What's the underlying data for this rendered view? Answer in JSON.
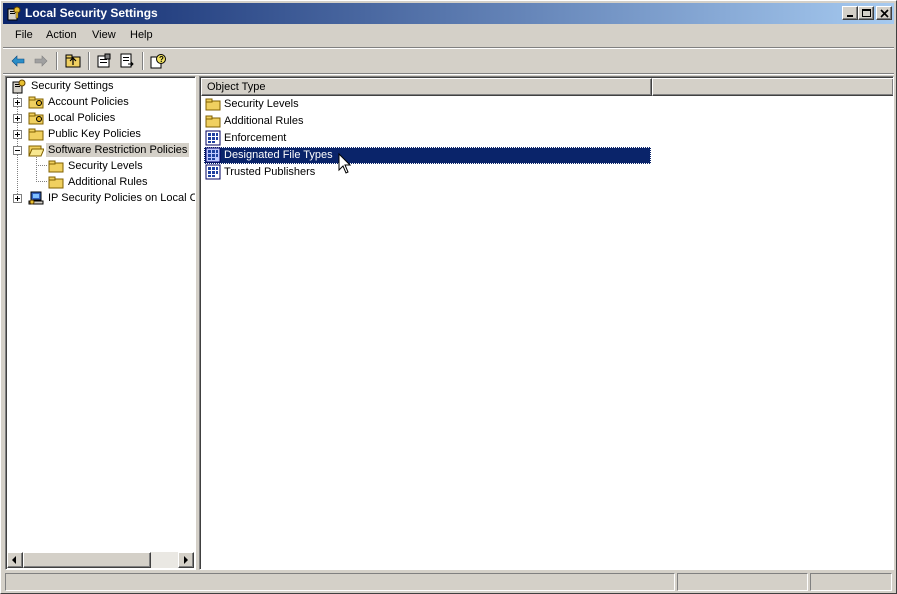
{
  "window": {
    "title": "Local Security Settings",
    "controls": [
      "minimize-icon",
      "maximize-icon",
      "close-icon"
    ]
  },
  "menu": {
    "items": [
      {
        "label": "File"
      },
      {
        "label": "Action"
      },
      {
        "label": "View"
      },
      {
        "label": "Help"
      }
    ]
  },
  "toolbar": {
    "buttons": [
      "back-arrow-icon",
      "forward-arrow-icon",
      "up-folder-icon",
      "properties-icon",
      "export-list-icon",
      "help-icon"
    ]
  },
  "tree": {
    "root": "Security Settings",
    "items": [
      {
        "label": "Account Policies",
        "icon": "folder-key-icon",
        "expander": "plus"
      },
      {
        "label": "Local Policies",
        "icon": "folder-key-icon",
        "expander": "plus"
      },
      {
        "label": "Public Key Policies",
        "icon": "folder-icon",
        "expander": "plus"
      },
      {
        "label": "Software Restriction Policies",
        "icon": "folder-open-icon",
        "expander": "minus",
        "selected": true
      },
      {
        "label": "Security Levels",
        "icon": "folder-icon"
      },
      {
        "label": "Additional Rules",
        "icon": "folder-icon"
      },
      {
        "label": "IP Security Policies on Local Co",
        "icon": "ip-security-icon",
        "expander": "plus"
      }
    ]
  },
  "list": {
    "columns": [
      "Object Type"
    ],
    "rows": [
      {
        "label": "Security Levels",
        "icon": "folder-icon"
      },
      {
        "label": "Additional Rules",
        "icon": "folder-icon"
      },
      {
        "label": "Enforcement",
        "icon": "policy-icon"
      },
      {
        "label": "Designated File Types",
        "icon": "policy-icon",
        "selected": true
      },
      {
        "label": "Trusted Publishers",
        "icon": "policy-icon"
      }
    ]
  },
  "colors": {
    "titlebar_start": "#0a246a",
    "titlebar_end": "#a6caf0",
    "selection": "#0a246a",
    "face": "#d4d0c8"
  }
}
